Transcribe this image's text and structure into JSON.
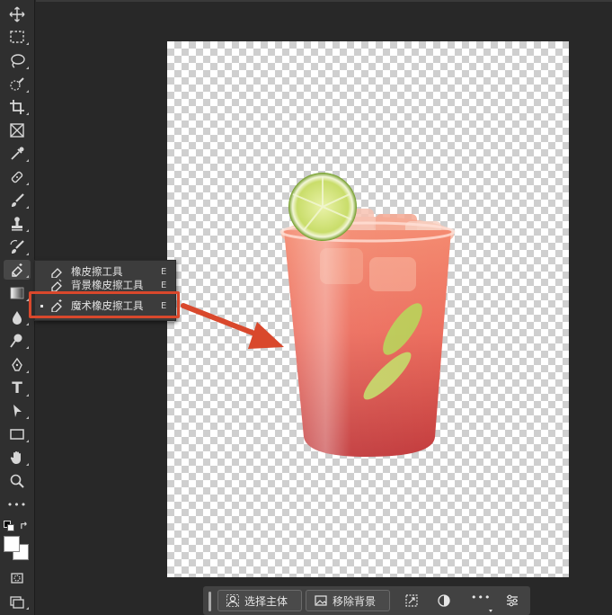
{
  "toolbar": {
    "tools": [
      {
        "id": "move",
        "icon": "move-icon"
      },
      {
        "id": "marquee",
        "icon": "rect-marquee-icon"
      },
      {
        "id": "lasso",
        "icon": "lasso-icon"
      },
      {
        "id": "quick-select",
        "icon": "quick-select-icon"
      },
      {
        "id": "crop",
        "icon": "crop-icon"
      },
      {
        "id": "frame",
        "icon": "frame-icon"
      },
      {
        "id": "eyedropper",
        "icon": "eyedropper-icon"
      },
      {
        "id": "healing",
        "icon": "healing-brush-icon"
      },
      {
        "id": "brush",
        "icon": "brush-icon"
      },
      {
        "id": "stamp",
        "icon": "clone-stamp-icon"
      },
      {
        "id": "history-brush",
        "icon": "history-brush-icon"
      },
      {
        "id": "eraser",
        "icon": "eraser-icon"
      },
      {
        "id": "gradient",
        "icon": "gradient-icon"
      },
      {
        "id": "blur",
        "icon": "blur-drop-icon"
      },
      {
        "id": "dodge",
        "icon": "dodge-icon"
      },
      {
        "id": "pen",
        "icon": "pen-icon"
      },
      {
        "id": "type",
        "icon": "type-icon"
      },
      {
        "id": "path-select",
        "icon": "path-select-icon"
      },
      {
        "id": "shape",
        "icon": "rectangle-shape-icon"
      },
      {
        "id": "hand",
        "icon": "hand-icon"
      },
      {
        "id": "zoom",
        "icon": "zoom-icon"
      },
      {
        "id": "more",
        "icon": "more-tools-icon"
      }
    ],
    "type_glyph": "T",
    "more_glyph": "•••",
    "colors": {
      "foreground": "#ffffff",
      "background": "#ffffff"
    }
  },
  "flyout": {
    "items": [
      {
        "label": "橡皮擦工具",
        "shortcut": "E",
        "icon": "eraser-icon"
      },
      {
        "label": "背景橡皮擦工具",
        "shortcut": "E",
        "icon": "background-eraser-icon"
      },
      {
        "label": "魔术橡皮擦工具",
        "shortcut": "E",
        "icon": "magic-eraser-icon",
        "selected": true
      }
    ]
  },
  "annotation": {
    "color": "#d9482c"
  },
  "taskbar": {
    "select_subject": "选择主体",
    "remove_background": "移除背景",
    "more_glyph": "•••"
  }
}
